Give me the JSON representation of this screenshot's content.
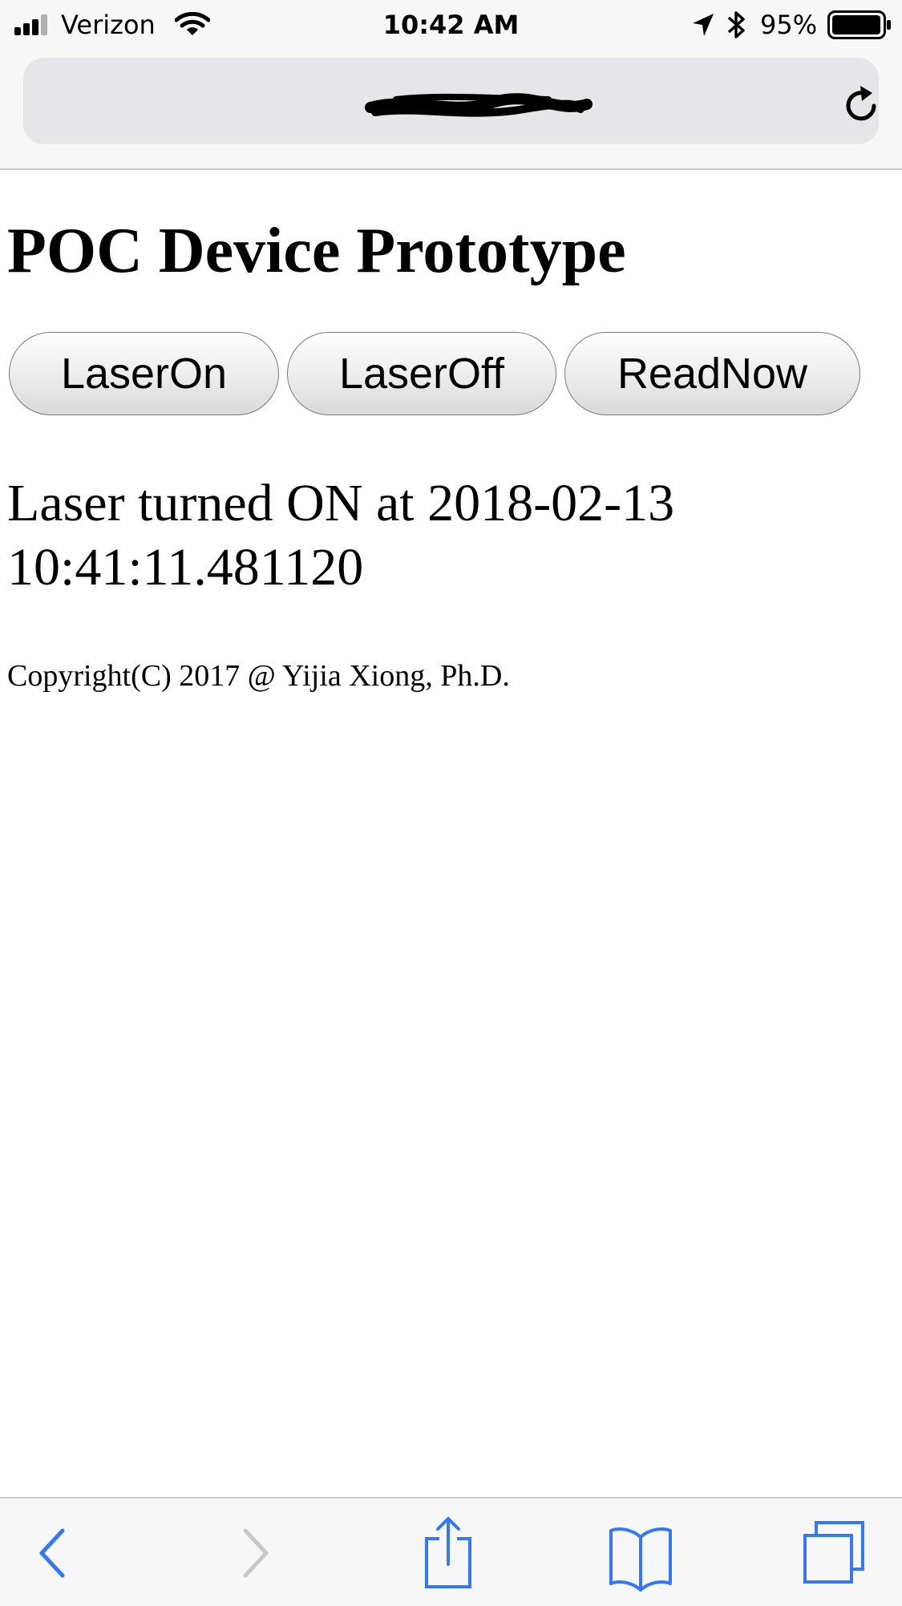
{
  "status_bar": {
    "carrier": "Verizon",
    "time": "10:42 AM",
    "battery": "95%"
  },
  "browser": {
    "url": "",
    "reload_icon": "reload-icon"
  },
  "page": {
    "title": "POC Device Prototype",
    "buttons": [
      "LaserOn",
      "LaserOff",
      "ReadNow"
    ],
    "status_message": "Laser turned ON at 2018-02-13 10:41:11.481120",
    "copyright": "Copyright(C) 2017 @ Yijia Xiong, Ph.D."
  },
  "toolbar": {
    "icons": [
      "back-icon",
      "forward-icon",
      "share-icon",
      "bookmarks-icon",
      "tabs-icon"
    ],
    "accent_color": "#3478f6",
    "disabled_color": "#c7c7cc"
  }
}
